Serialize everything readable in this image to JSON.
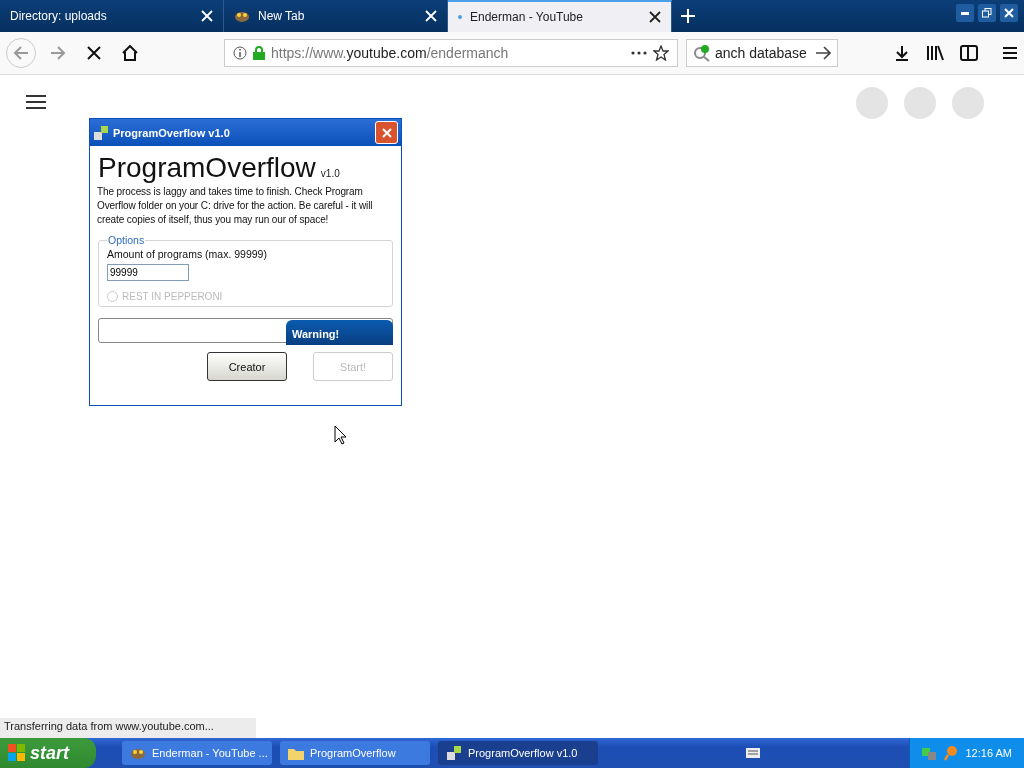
{
  "tabs": [
    {
      "label": "Directory: uploads",
      "kind": "plain",
      "selected": false
    },
    {
      "label": "New Tab",
      "kind": "favicon",
      "selected": false
    },
    {
      "label": "Enderman - YouTube",
      "kind": "loading",
      "selected": true
    }
  ],
  "address": {
    "scheme": "https://www.",
    "domain": "youtube.com",
    "path": "/endermanch"
  },
  "search": {
    "value": "anch database"
  },
  "dialog": {
    "title": "ProgramOverflow v1.0",
    "heading": "ProgramOverflow",
    "version": "v1.0",
    "description": "The process is laggy and takes time to finish. Check Program Overflow folder on your C: drive for the action. Be careful - it will create copies of itself, thus you may run our of space!",
    "options_legend": "Options",
    "amount_label": "Amount of programs (max. 99999)",
    "amount_value": "99999",
    "radio": {
      "label": "REST IN PEPPERONI",
      "selected": false,
      "disabled": true
    },
    "progress": {
      "level": 0
    },
    "warning": "Warning!",
    "buttons": [
      {
        "label": "Creator",
        "disabled": false
      },
      {
        "label": "Start!",
        "disabled": true
      }
    ]
  },
  "status_bar": "Transferring data from www.youtube.com...",
  "taskbar": {
    "start": "start",
    "items": [
      {
        "label": "Enderman - YouTube ...",
        "kind": "browser",
        "selected": false
      },
      {
        "label": "ProgramOverflow",
        "kind": "folder",
        "selected": false
      },
      {
        "label": "ProgramOverflow v1.0",
        "kind": "app",
        "selected": true
      }
    ],
    "clock": "12:16 AM"
  }
}
